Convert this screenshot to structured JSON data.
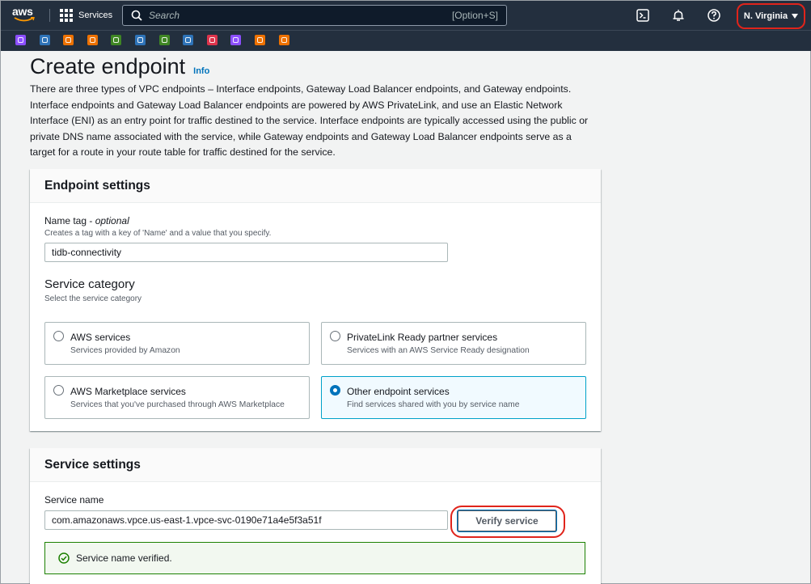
{
  "nav": {
    "logo_text": "aws",
    "services_label": "Services",
    "search_placeholder": "Search",
    "search_shortcut": "[Option+S]",
    "region_label": "N. Virginia",
    "icons": [
      "terminal-icon",
      "bell-icon",
      "help-icon"
    ]
  },
  "favorites": [
    {
      "name": "fav-service-1",
      "color": "#8c4fff"
    },
    {
      "name": "fav-service-2",
      "color": "#2e73b8"
    },
    {
      "name": "fav-service-3",
      "color": "#ed7100"
    },
    {
      "name": "fav-service-4",
      "color": "#ed7100"
    },
    {
      "name": "fav-service-5",
      "color": "#3f8624"
    },
    {
      "name": "fav-service-6",
      "color": "#2e73b8"
    },
    {
      "name": "fav-service-7",
      "color": "#3f8624"
    },
    {
      "name": "fav-service-8",
      "color": "#2e73b8"
    },
    {
      "name": "fav-service-9",
      "color": "#dd344c"
    },
    {
      "name": "fav-service-10",
      "color": "#8c4fff"
    },
    {
      "name": "fav-service-11",
      "color": "#ed7100"
    },
    {
      "name": "fav-service-12",
      "color": "#ed7100"
    }
  ],
  "page": {
    "title": "Create endpoint",
    "info_link": "Info",
    "description": "There are three types of VPC endpoints – Interface endpoints, Gateway Load Balancer endpoints, and Gateway endpoints. Interface endpoints and Gateway Load Balancer endpoints are powered by AWS PrivateLink, and use an Elastic Network Interface (ENI) as an entry point for traffic destined to the service. Interface endpoints are typically accessed using the public or private DNS name associated with the service, while Gateway endpoints and Gateway Load Balancer endpoints serve as a target for a route in your route table for traffic destined for the service."
  },
  "endpoint_settings": {
    "header": "Endpoint settings",
    "name_tag_label": "Name tag - ",
    "name_tag_optional": "optional",
    "name_tag_desc": "Creates a tag with a key of 'Name' and a value that you specify.",
    "name_tag_value": "tidb-connectivity",
    "service_category_title": "Service category",
    "service_category_desc": "Select the service category",
    "options": [
      {
        "title": "AWS services",
        "desc": "Services provided by Amazon",
        "selected": false
      },
      {
        "title": "PrivateLink Ready partner services",
        "desc": "Services with an AWS Service Ready designation",
        "selected": false
      },
      {
        "title": "AWS Marketplace services",
        "desc": "Services that you've purchased through AWS Marketplace",
        "selected": false
      },
      {
        "title": "Other endpoint services",
        "desc": "Find services shared with you by service name",
        "selected": true
      }
    ]
  },
  "service_settings": {
    "header": "Service settings",
    "service_name_label": "Service name",
    "service_name_value": "com.amazonaws.vpce.us-east-1.vpce-svc-0190e71a4e5f3a51f",
    "verify_button": "Verify service",
    "alert_text": "Service name verified."
  },
  "colors": {
    "nav_bg": "#232f3e",
    "link": "#0073bb",
    "success": "#1d8102",
    "highlight": "#e0241b"
  }
}
